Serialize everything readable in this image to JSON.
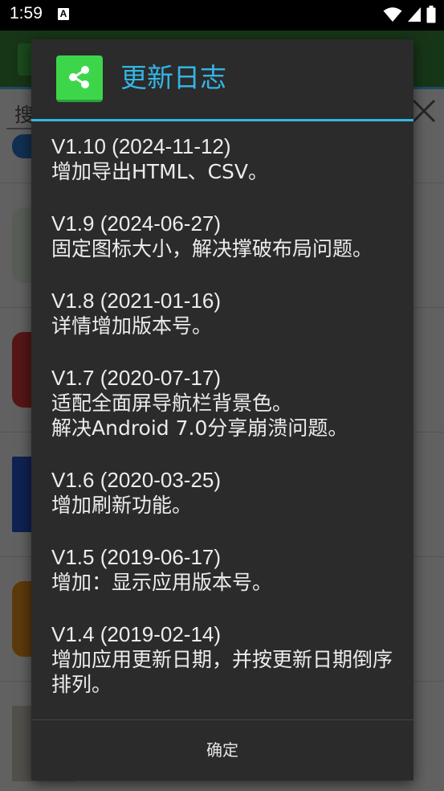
{
  "status_bar": {
    "time": "1:59",
    "notification_icon": "a-icon",
    "icons": [
      "wifi-icon",
      "signal-icon",
      "battery-icon"
    ]
  },
  "background": {
    "search_placeholder": "搜"
  },
  "dialog": {
    "icon": "share-icon",
    "title": "更新日志",
    "entries": [
      {
        "version": "V1.10 (2024-11-12)",
        "lines": [
          "增加导出HTML、CSV。"
        ]
      },
      {
        "version": "V1.9 (2024-06-27)",
        "lines": [
          "固定图标大小，解决撑破布局问题。"
        ]
      },
      {
        "version": "V1.8 (2021-01-16)",
        "lines": [
          "详情增加版本号。"
        ]
      },
      {
        "version": "V1.7 (2020-07-17)",
        "lines": [
          "适配全面屏导航栏背景色。",
          "解决Android 7.0分享崩溃问题。"
        ]
      },
      {
        "version": "V1.6 (2020-03-25)",
        "lines": [
          "增加刷新功能。"
        ]
      },
      {
        "version": "V1.5 (2019-06-17)",
        "lines": [
          "增加：显示应用版本号。"
        ]
      },
      {
        "version": "V1.4 (2019-02-14)",
        "lines": [
          "增加应用更新日期，并按更新日期倒序排列。"
        ]
      }
    ],
    "ok_label": "确定"
  },
  "colors": {
    "accent": "#33b5e5",
    "dialog_bg": "#2b2b2b",
    "icon_green": "#3dd64b"
  }
}
